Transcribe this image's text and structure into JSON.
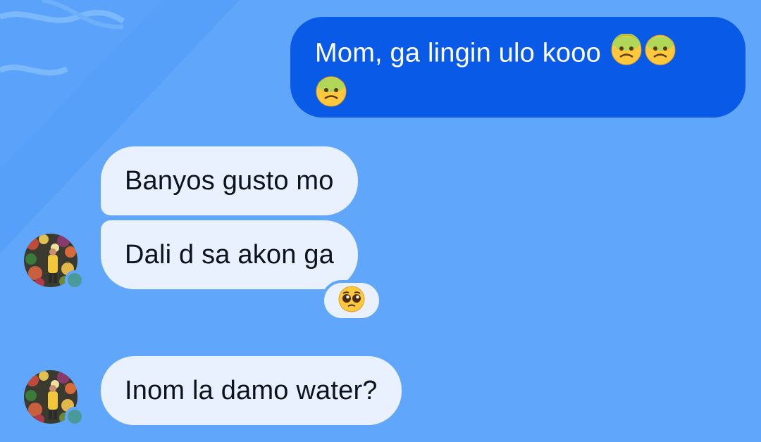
{
  "chat": {
    "messages": [
      {
        "sender": "self",
        "text": "Mom, ga lingin ulo kooo",
        "emoji_icon": "nauseated-face-emoji"
      },
      {
        "sender": "other",
        "text": "Banyos gusto mo"
      },
      {
        "sender": "other",
        "text": "Dali d sa akon ga",
        "reaction_icon": "pleading-face-emoji"
      },
      {
        "sender": "other",
        "text": "Inom la damo water?"
      }
    ],
    "colors": {
      "background": "#60a6fb",
      "outgoing_bubble": "#0a5ae8",
      "incoming_bubble": "#e8f1fd",
      "status_dot": "#4a9a9a"
    }
  }
}
